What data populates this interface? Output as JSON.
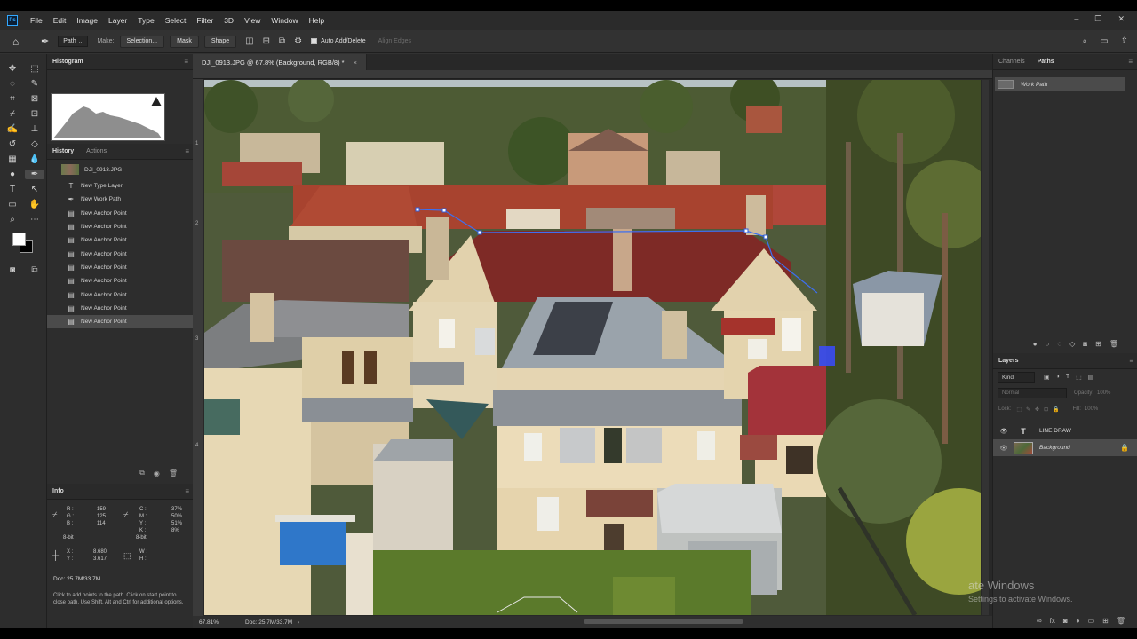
{
  "menubar": {
    "logo": "Ps",
    "items": [
      "File",
      "Edit",
      "Image",
      "Layer",
      "Type",
      "Select",
      "Filter",
      "3D",
      "View",
      "Window",
      "Help"
    ]
  },
  "options": {
    "tool_mode": "Path",
    "make_label": "Make:",
    "selection_btn": "Selection...",
    "mask_btn": "Mask",
    "shape_btn": "Shape",
    "auto_add_delete": "Auto Add/Delete",
    "align_edges": "Align Edges"
  },
  "histogram": {
    "tab": "Histogram"
  },
  "history": {
    "tabs": [
      "History",
      "Actions"
    ],
    "snapshot": "DJI_0913.JPG",
    "steps": [
      {
        "icon": "T",
        "label": "New Type Layer"
      },
      {
        "icon": "✒",
        "label": "New Work Path"
      },
      {
        "icon": "▤",
        "label": "New Anchor Point"
      },
      {
        "icon": "▤",
        "label": "New Anchor Point"
      },
      {
        "icon": "▤",
        "label": "New Anchor Point"
      },
      {
        "icon": "▤",
        "label": "New Anchor Point"
      },
      {
        "icon": "▤",
        "label": "New Anchor Point"
      },
      {
        "icon": "▤",
        "label": "New Anchor Point"
      },
      {
        "icon": "▤",
        "label": "New Anchor Point"
      },
      {
        "icon": "▤",
        "label": "New Anchor Point"
      },
      {
        "icon": "▤",
        "label": "New Anchor Point"
      }
    ]
  },
  "info": {
    "tab": "Info",
    "r_label": "R :",
    "r": "159",
    "g_label": "G :",
    "g": "125",
    "b_label": "B :",
    "b": "114",
    "c_label": "C :",
    "c": "37%",
    "m_label": "M :",
    "m": "50%",
    "y_label": "Y :",
    "y": "51%",
    "k_label": "K :",
    "k": "8%",
    "bit1": "8-bit",
    "bit2": "8-bit",
    "x_label": "X :",
    "x": "8.680",
    "yy_label": "Y :",
    "yy": "3.617",
    "w_label": "W :",
    "h_label": "H :",
    "doc": "Doc: 25.7M/33.7M",
    "hint": "Click to add points to the path.  Click on start point to close path.  Use Shift, Alt and Ctrl for additional options."
  },
  "document": {
    "tab_title": "DJI_0913.JPG @ 67.8% (Background, RGB/8) *",
    "close": "×",
    "zoom": "67.81%",
    "doc_size": "Doc: 25.7M/33.7M",
    "ruler_marks": [
      "1",
      "2",
      "3",
      "4"
    ]
  },
  "right": {
    "tabs": [
      "Channels",
      "Paths"
    ],
    "work_path": "Work Path",
    "layers_tab": "Layers",
    "kind": "Kind",
    "blend": "Normal",
    "opacity_label": "Opacity:",
    "opacity": "100%",
    "lock_label": "Lock:",
    "fill_label": "Fill:",
    "fill": "100%",
    "layers": [
      {
        "name": "LINE DRAW",
        "type": "text"
      },
      {
        "name": "Background",
        "type": "image"
      }
    ]
  },
  "watermark": {
    "line1": "ate Windows",
    "line2": "Settings to activate Windows."
  }
}
